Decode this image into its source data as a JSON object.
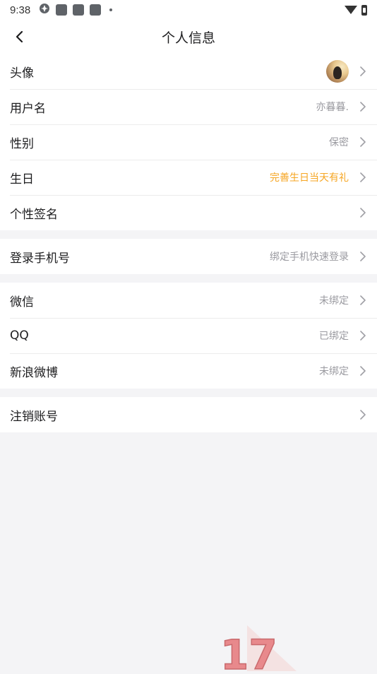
{
  "status_bar": {
    "time": "9:38"
  },
  "header": {
    "title": "个人信息"
  },
  "groups": {
    "profile": {
      "avatar": {
        "label": "头像"
      },
      "username": {
        "label": "用户名",
        "value": "亦暮暮."
      },
      "gender": {
        "label": "性别",
        "value": "保密"
      },
      "birthday": {
        "label": "生日",
        "value": "完善生日当天有礼"
      },
      "signature": {
        "label": "个性签名"
      }
    },
    "login": {
      "phone": {
        "label": "登录手机号",
        "value": "绑定手机快速登录"
      }
    },
    "bindings": {
      "wechat": {
        "label": "微信",
        "value": "未绑定"
      },
      "qq": {
        "label": "QQ",
        "value": "已绑定"
      },
      "weibo": {
        "label": "新浪微博",
        "value": "未绑定"
      }
    },
    "account": {
      "delete": {
        "label": "注销账号"
      }
    }
  },
  "watermark": {
    "text": "17"
  },
  "colors": {
    "accent": "#f6a623",
    "secondary_text": "#9a9aa0",
    "background": "#f4f4f6"
  }
}
